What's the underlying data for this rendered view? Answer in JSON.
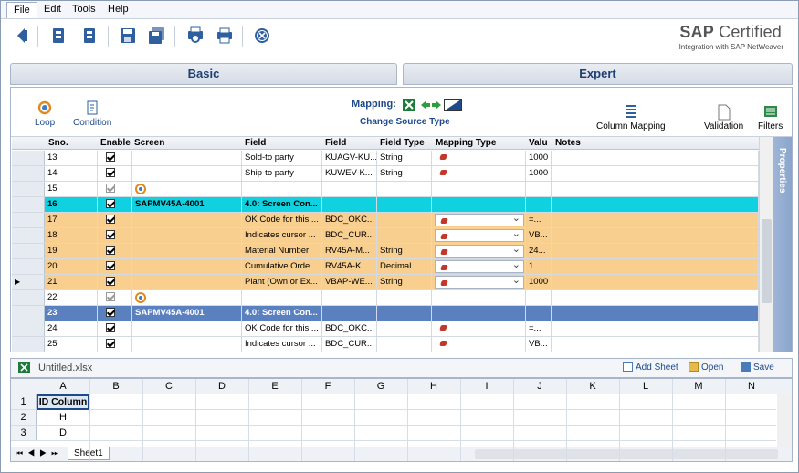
{
  "menu": [
    "File",
    "Edit",
    "Tools",
    "Help"
  ],
  "brand": {
    "title_bold": "SAP",
    "title_rest": " Certified",
    "subtitle": "Integration with SAP NetWeaver"
  },
  "tabs": {
    "basic": "Basic",
    "expert": "Expert"
  },
  "mapping_toolbar": {
    "loop": "Loop",
    "condition": "Condition",
    "mapping_label": "Mapping:",
    "change_source": "Change Source Type",
    "column_mapping": "Column Mapping",
    "validation": "Validation",
    "filters": "Filters"
  },
  "grid_headers": [
    "Sno.",
    "Enable",
    "Screen",
    "Field Description",
    "Field Name",
    "Field Type",
    "Mapping Type",
    "Value",
    "Notes"
  ],
  "grid_header_display": {
    "field_desc": "Field",
    "field_name": "Field",
    "value": "Valu"
  },
  "rows": [
    {
      "sno": "13",
      "enabled": true,
      "screen": "",
      "desc": "Sold-to party",
      "name": "KUAGV-KU...",
      "type": "String",
      "map": "icon",
      "value": "1000",
      "style": "white"
    },
    {
      "sno": "14",
      "enabled": true,
      "screen": "",
      "desc": "Ship-to party",
      "name": "KUWEV-K...",
      "type": "String",
      "map": "icon",
      "value": "1000",
      "style": "white"
    },
    {
      "sno": "15",
      "enabled": true,
      "screen": "loop",
      "desc": "",
      "name": "",
      "type": "",
      "map": "",
      "value": "",
      "style": "white"
    },
    {
      "sno": "16",
      "enabled": true,
      "screen": "SAPMV45A-4001",
      "desc": "4.0: Screen Con...",
      "name": "",
      "type": "",
      "map": "",
      "value": "",
      "style": "cyan"
    },
    {
      "sno": "17",
      "enabled": true,
      "screen": "",
      "desc": "OK Code for this ...",
      "name": "BDC_OKC...",
      "type": "",
      "map": "dropdown",
      "value": "=...",
      "style": "orange"
    },
    {
      "sno": "18",
      "enabled": true,
      "screen": "",
      "desc": "Indicates cursor ...",
      "name": "BDC_CUR...",
      "type": "",
      "map": "dropdown",
      "value": "VB...",
      "style": "orange"
    },
    {
      "sno": "19",
      "enabled": true,
      "screen": "",
      "desc": "Material Number",
      "name": "RV45A-M...",
      "type": "String",
      "map": "dropdown",
      "value": "24...",
      "style": "orange"
    },
    {
      "sno": "20",
      "enabled": true,
      "screen": "",
      "desc": "Cumulative Orde...",
      "name": "RV45A-K...",
      "type": "Decimal",
      "map": "dropdown",
      "value": "1",
      "style": "orange"
    },
    {
      "sno": "21",
      "enabled": true,
      "screen": "",
      "desc": "Plant (Own or Ex...",
      "name": "VBAP-WE...",
      "type": "String",
      "map": "dropdown",
      "value": "1000",
      "style": "orange"
    },
    {
      "sno": "22",
      "enabled": true,
      "screen": "loop",
      "desc": "",
      "name": "",
      "type": "",
      "map": "",
      "value": "",
      "style": "white"
    },
    {
      "sno": "23",
      "enabled": true,
      "screen": "SAPMV45A-4001",
      "desc": "4.0: Screen Con...",
      "name": "",
      "type": "",
      "map": "",
      "value": "",
      "style": "blue"
    },
    {
      "sno": "24",
      "enabled": true,
      "screen": "",
      "desc": "OK Code for this ...",
      "name": "BDC_OKC...",
      "type": "",
      "map": "icon",
      "value": "=...",
      "style": "white"
    },
    {
      "sno": "25",
      "enabled": true,
      "screen": "",
      "desc": "Indicates cursor ...",
      "name": "BDC_CUR...",
      "type": "",
      "map": "icon",
      "value": "VB...",
      "style": "white"
    }
  ],
  "properties_label": "Properties",
  "sheet": {
    "filename": "Untitled.xlsx",
    "add_sheet": "Add Sheet",
    "open": "Open",
    "save": "Save",
    "columns": [
      "A",
      "B",
      "C",
      "D",
      "E",
      "F",
      "G",
      "H",
      "I",
      "J",
      "K",
      "L",
      "M",
      "N"
    ],
    "rows": [
      {
        "n": "1",
        "a": "ID Column"
      },
      {
        "n": "2",
        "a": "H"
      },
      {
        "n": "3",
        "a": "D"
      }
    ],
    "tab": "Sheet1"
  },
  "colors": {
    "cyan": "#10d1e0",
    "orange": "#f8cf8f",
    "blue": "#5b80c0",
    "accent": "#1e4a8a"
  }
}
